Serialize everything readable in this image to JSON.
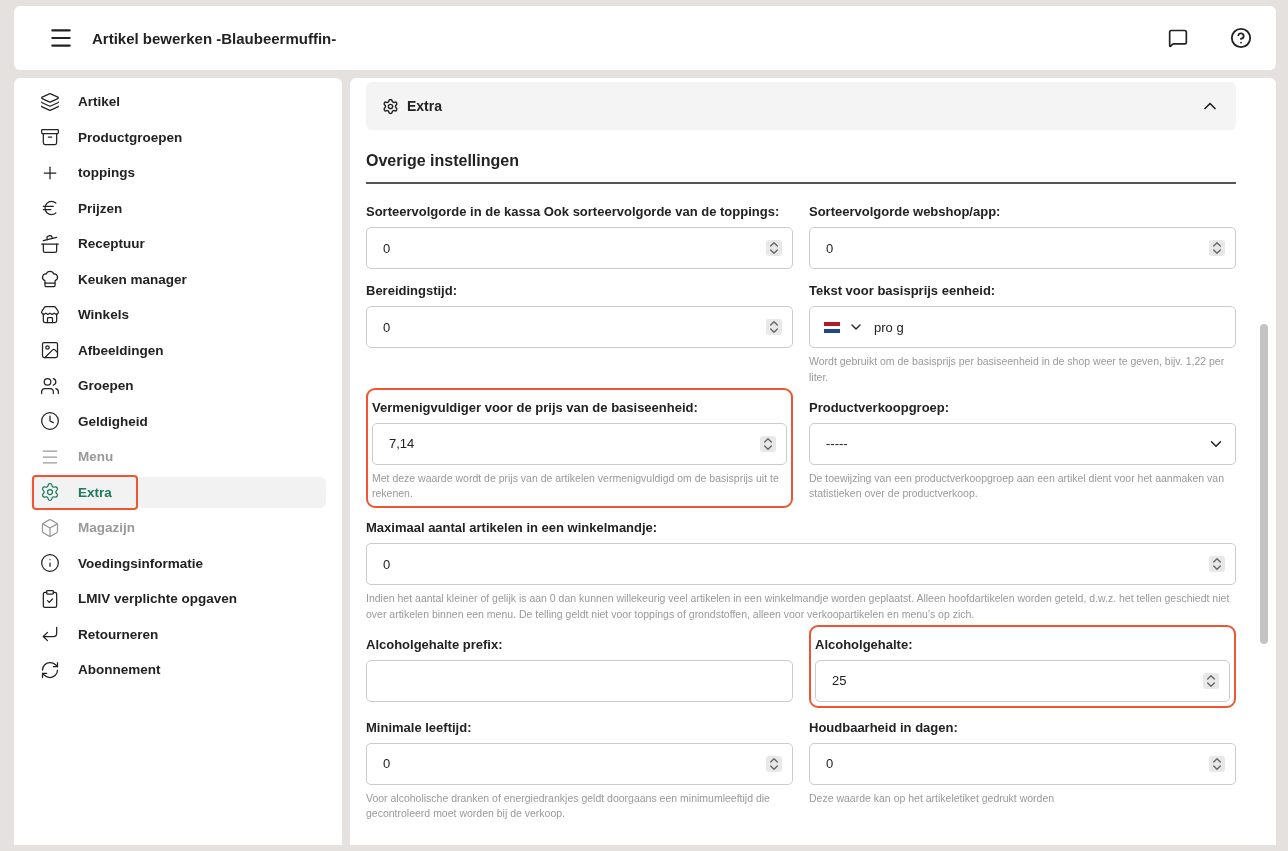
{
  "header": {
    "title": "Artikel bewerken -Blaubeermuffin-"
  },
  "sidebar": {
    "items": [
      {
        "label": "Artikel",
        "selected": false,
        "disabled": false,
        "highlighted": false
      },
      {
        "label": "Productgroepen",
        "selected": false,
        "disabled": false,
        "highlighted": false
      },
      {
        "label": "toppings",
        "selected": false,
        "disabled": false,
        "highlighted": false
      },
      {
        "label": "Prijzen",
        "selected": false,
        "disabled": false,
        "highlighted": false
      },
      {
        "label": "Receptuur",
        "selected": false,
        "disabled": false,
        "highlighted": false
      },
      {
        "label": "Keuken manager",
        "selected": false,
        "disabled": false,
        "highlighted": false
      },
      {
        "label": "Winkels",
        "selected": false,
        "disabled": false,
        "highlighted": false
      },
      {
        "label": "Afbeeldingen",
        "selected": false,
        "disabled": false,
        "highlighted": false
      },
      {
        "label": "Groepen",
        "selected": false,
        "disabled": false,
        "highlighted": false
      },
      {
        "label": "Geldigheid",
        "selected": false,
        "disabled": false,
        "highlighted": false
      },
      {
        "label": "Menu",
        "selected": false,
        "disabled": true,
        "highlighted": false
      },
      {
        "label": "Extra",
        "selected": true,
        "disabled": false,
        "highlighted": true
      },
      {
        "label": "Magazijn",
        "selected": false,
        "disabled": true,
        "highlighted": false
      },
      {
        "label": "Voedingsinformatie",
        "selected": false,
        "disabled": false,
        "highlighted": false
      },
      {
        "label": "LMIV verplichte opgaven",
        "selected": false,
        "disabled": false,
        "highlighted": false
      },
      {
        "label": "Retourneren",
        "selected": false,
        "disabled": false,
        "highlighted": false
      },
      {
        "label": "Abonnement",
        "selected": false,
        "disabled": false,
        "highlighted": false
      }
    ]
  },
  "section": {
    "title": "Extra",
    "expanded": true,
    "heading": "Overige instellingen",
    "fields": [
      {
        "kind": "number",
        "label": "Sorteervolgorde in de kassa Ook sorteervolgorde van de toppings:",
        "value": "0",
        "wide": false,
        "highlighted": false
      },
      {
        "kind": "number",
        "label": "Sorteervolgorde webshop/app:",
        "value": "0",
        "wide": false,
        "highlighted": false
      },
      {
        "kind": "number",
        "label": "Bereidingstijd:",
        "value": "0",
        "wide": false,
        "highlighted": false
      },
      {
        "kind": "language",
        "label": "Tekst voor basisprijs eenheid:",
        "value": "pro g",
        "hint": "Wordt gebruikt om de basisprijs per basiseenheid in de shop weer te geven, bijv. 1,22 per liter.",
        "wide": false,
        "highlighted": false
      },
      {
        "kind": "number",
        "label": "Vermenigvuldiger voor de prijs van de basiseenheid:",
        "value": "7,14",
        "hint": "Met deze waarde wordt de prijs van de artikelen vermenigvuldigd om de basisprijs uit te rekenen.",
        "wide": false,
        "highlighted": true
      },
      {
        "kind": "select",
        "label": "Productverkoopgroep:",
        "value": "-----",
        "hint": "De toewijzing van een productverkoopgroep aan een artikel dient voor het aanmaken van statistieken over de productverkoop.",
        "wide": false,
        "highlighted": false
      },
      {
        "kind": "number",
        "label": "Maximaal aantal artikelen in een winkelmandje:",
        "value": "0",
        "hint": "Indien het aantal kleiner of gelijk is aan 0 dan kunnen willekeurig veel artikelen in een winkelmandje worden geplaatst. Alleen hoofdartikelen worden geteld, d.w.z. het tellen geschiedt niet over artikelen binnen een menu. De telling geldt niet voor toppings of grondstoffen, alleen voor verkoopartikelen en menu's op zich.",
        "wide": true,
        "highlighted": false
      },
      {
        "kind": "text",
        "label": "Alcoholgehalte prefix:",
        "wide": false,
        "highlighted": false
      },
      {
        "kind": "number",
        "label": "Alcoholgehalte:",
        "value": "25",
        "wide": false,
        "highlighted": true
      },
      {
        "kind": "number",
        "label": "Minimale leeftijd:",
        "value": "0",
        "hint": "Voor alcoholische dranken of energiedrankjes geldt doorgaans een minimumleeftijd die gecontroleerd moet worden bij de verkoop.",
        "wide": false,
        "highlighted": false
      },
      {
        "kind": "number",
        "label": "Houdbaarheid in dagen:",
        "value": "0",
        "hint": "Deze waarde kan op het artikeletiket gedrukt worden",
        "wide": false,
        "highlighted": false
      }
    ]
  }
}
